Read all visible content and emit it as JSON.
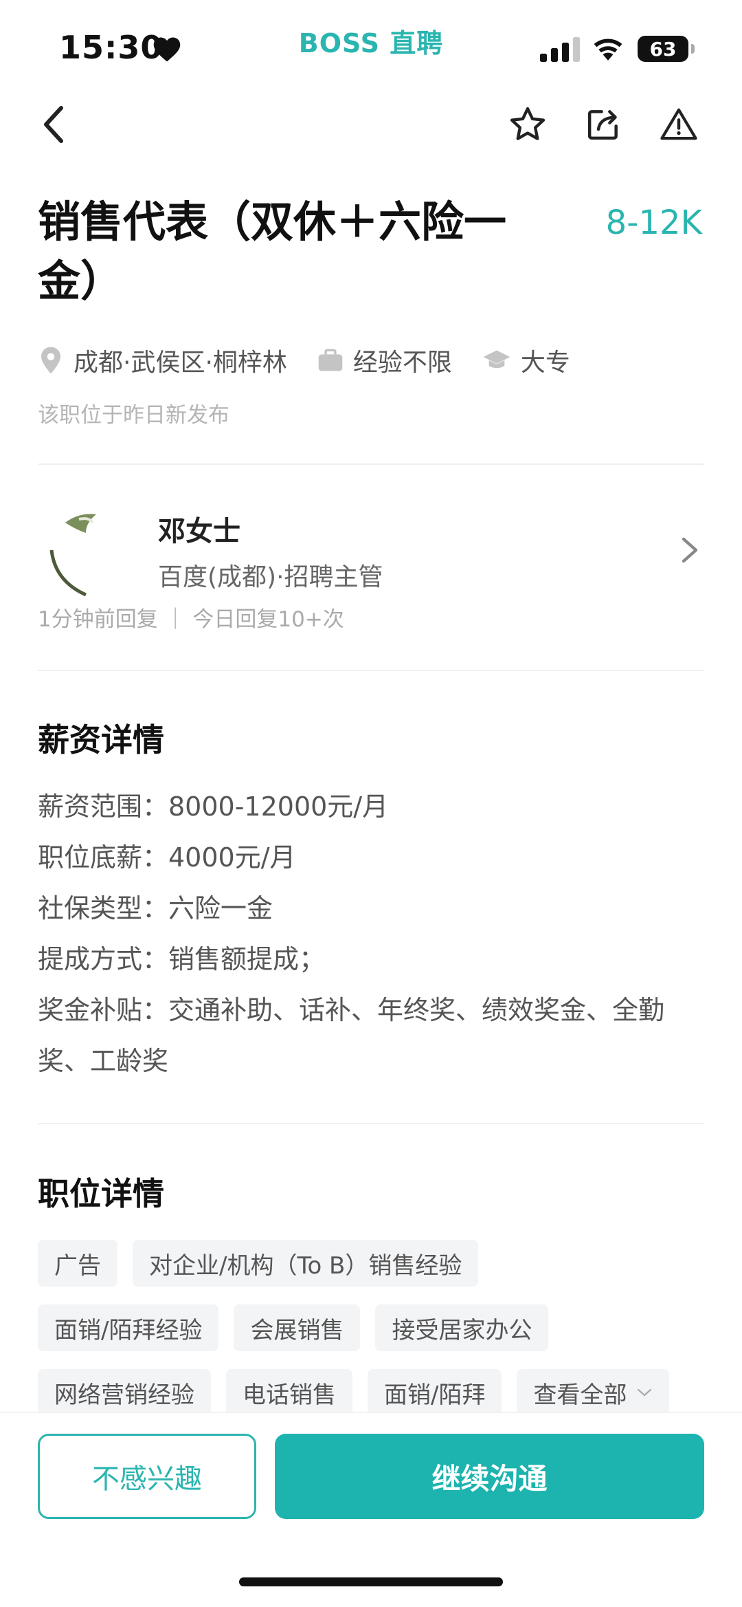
{
  "status_bar": {
    "time": "15:30",
    "app_brand": "BOSS 直聘",
    "battery": "63"
  },
  "job": {
    "title": "销售代表（双休＋六险一金）",
    "salary": "8-12K",
    "location": "成都·武侯区·桐梓林",
    "experience": "经验不限",
    "education": "大专",
    "publish_note": "该职位于昨日新发布"
  },
  "recruiter": {
    "name": "邓女士",
    "company_role": "百度(成都)·招聘主管",
    "activity": "1分钟前回复 ｜ 今日回复10+次"
  },
  "salary_section": {
    "title": "薪资详情",
    "lines": [
      "薪资范围：8000-12000元/月",
      "职位底薪：4000元/月",
      "社保类型：六险一金",
      "提成方式：销售额提成；",
      "奖金补贴：交通补助、话补、年终奖、绩效奖金、全勤奖、工龄奖"
    ]
  },
  "job_section": {
    "title": "职位详情",
    "tags_row1": [
      "广告",
      "对企业/机构（To B）销售经验"
    ],
    "tags_row2": [
      "面销/陌拜经验",
      "会展销售",
      "接受居家办公"
    ],
    "tags_row3": [
      "网络营销经验",
      "电话销售",
      "面销/陌拜"
    ],
    "view_all": "查看全部"
  },
  "actions": {
    "not_interested": "不感兴趣",
    "continue_chat": "继续沟通"
  },
  "colors": {
    "accent": "#2bb5b0",
    "button": "#1db3ae"
  }
}
